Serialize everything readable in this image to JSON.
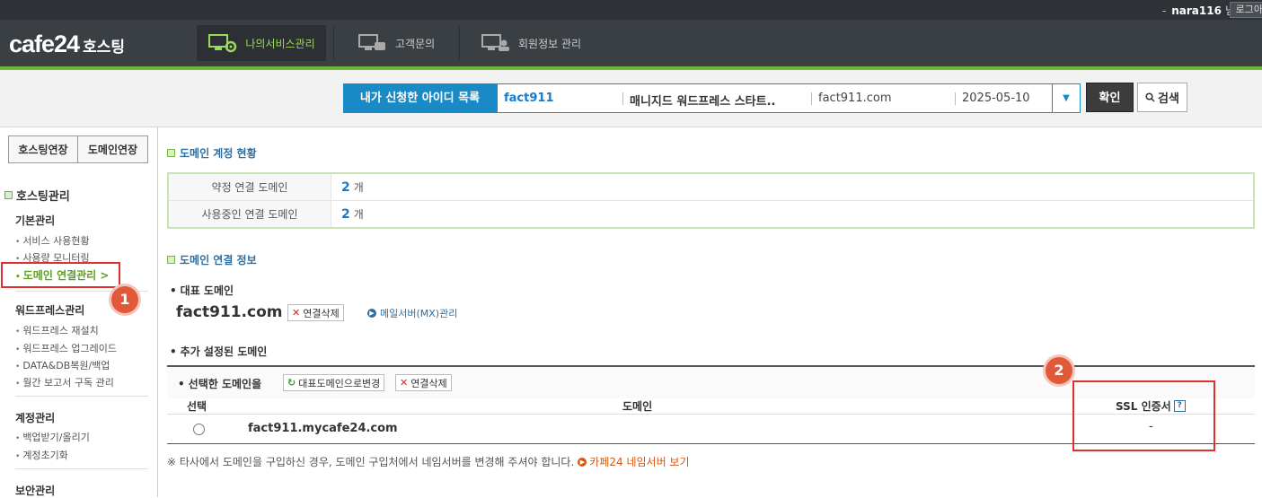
{
  "topbar": {
    "dash": "-",
    "username": "nara116",
    "honorific": "님",
    "logout": "로그아"
  },
  "header": {
    "logo": "cafe24",
    "logo_sub": "호스팅",
    "nav": [
      {
        "label": "나의서비스관리",
        "icon": "monitor-gear-icon",
        "active": true
      },
      {
        "label": "고객문의",
        "icon": "monitor-chat-icon",
        "active": false
      },
      {
        "label": "회원정보 관리",
        "icon": "monitor-user-icon",
        "active": false
      }
    ]
  },
  "id_selector": {
    "label": "내가 신청한 아이디 목록",
    "id": "fact911",
    "product": "매니지드 워드프레스 스타트..",
    "domain": "fact911.com",
    "date": "2025-05-10",
    "confirm": "확인",
    "search": "검색"
  },
  "sidebar": {
    "renew_hosting": "호스팅연장",
    "renew_domain": "도메인연장",
    "section": "호스팅관리",
    "groups": [
      {
        "title": "기본관리",
        "items": [
          "서비스 사용현황",
          "사용량 모니터링",
          "도메인 연결관리 >"
        ]
      },
      {
        "title": "워드프레스관리",
        "items": [
          "워드프레스 재설치",
          "워드프레스 업그레이드",
          "DATA&DB복원/백업",
          "월간 보고서 구독 관리"
        ]
      },
      {
        "title": "계정관리",
        "items": [
          "백업받기/올리기",
          "계정초기화"
        ]
      },
      {
        "title": "보안관리",
        "items": []
      }
    ]
  },
  "main": {
    "account_title": "도메인 계정 현황",
    "account_rows": [
      {
        "label": "약정 연결 도메인",
        "count": "2",
        "unit": "개"
      },
      {
        "label": "사용중인 연결 도메인",
        "count": "2",
        "unit": "개"
      }
    ],
    "link_title": "도메인 연결 정보",
    "primary_label": "대표 도메인",
    "primary_domain": "fact911.com",
    "disconnect": "연결삭제",
    "mx_link": "메일서버(MX)관리",
    "additional_label": "추가 설정된 도메인",
    "selected_label": "선택한 도메인을",
    "make_primary": "대표도메인으로변경",
    "columns": {
      "select": "선택",
      "domain": "도메인",
      "ssl": "SSL 인증서",
      "help": "?"
    },
    "rows": [
      {
        "domain": "fact911.mycafe24.com",
        "ssl": "-"
      }
    ],
    "note": "※ 타사에서 도메인을 구입하신 경우, 도메인 구입처에서 네임서버를 변경해 주셔야 합니다.",
    "note_link": "카페24 네임서버 보기"
  },
  "badges": {
    "one": "1",
    "two": "2"
  },
  "colors": {
    "accent_green": "#6fb43a",
    "blue": "#1a8ac6",
    "red": "#e02f2f",
    "badge": "#e05a3a"
  }
}
